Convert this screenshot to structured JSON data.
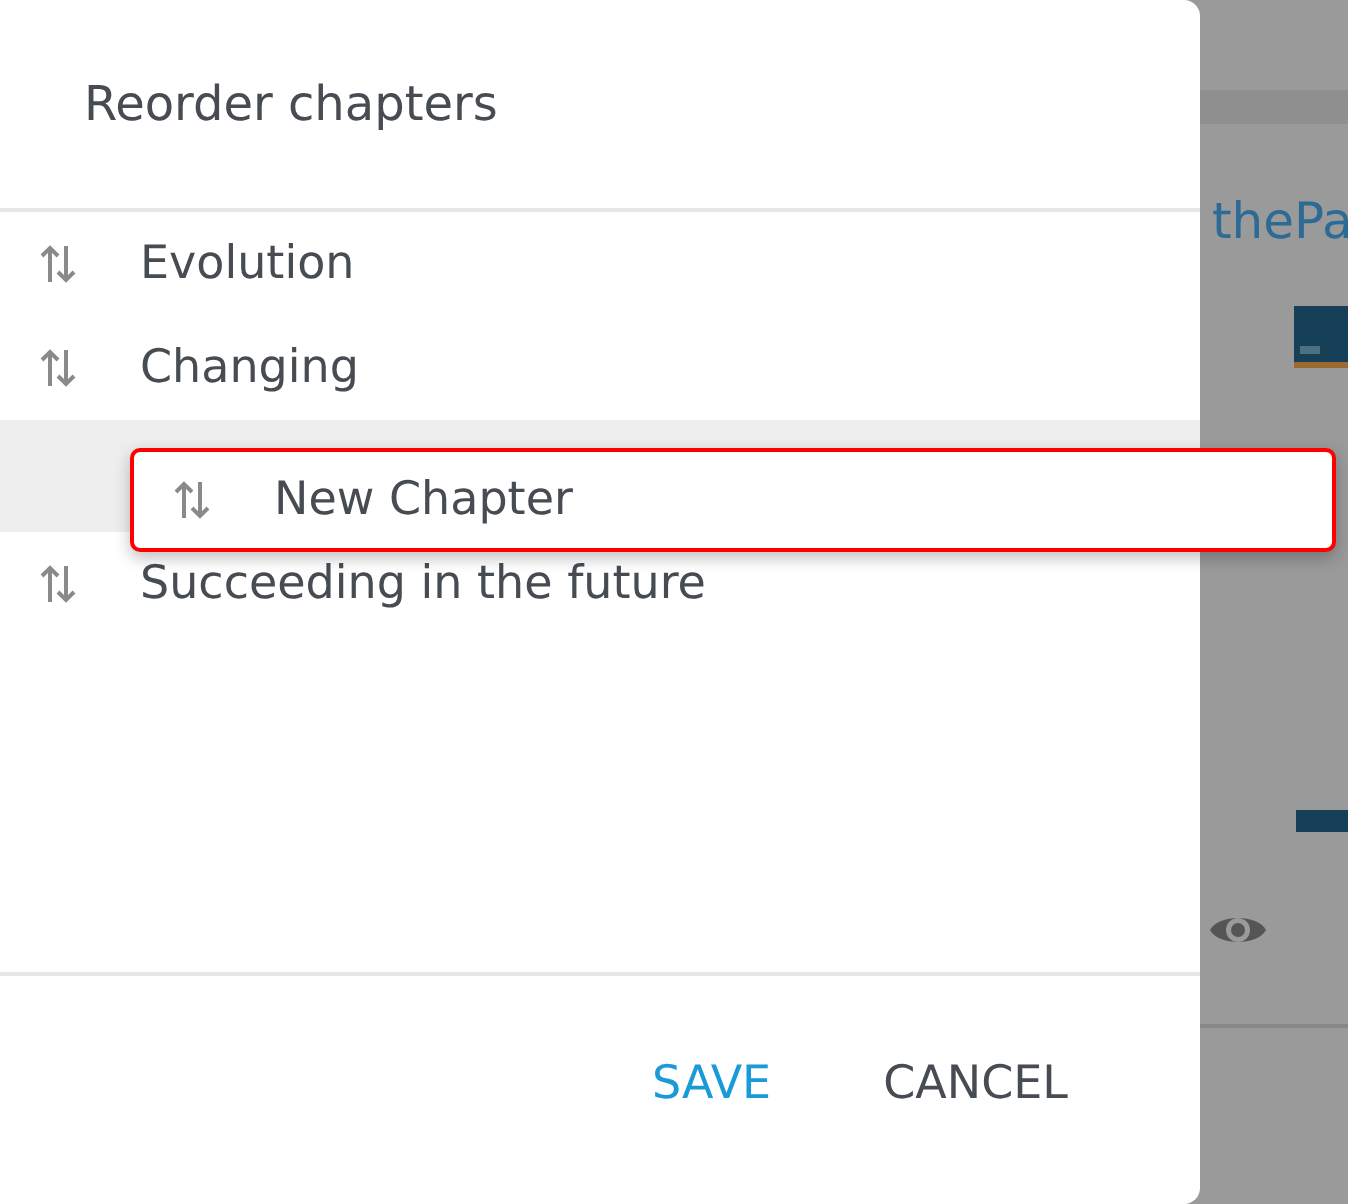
{
  "background": {
    "heading": "thePa"
  },
  "dialog": {
    "title": "Reorder chapters",
    "chapters": [
      {
        "kind": "item",
        "title": "Evolution"
      },
      {
        "kind": "item",
        "title": "Changing"
      },
      {
        "kind": "drop-placeholder"
      },
      {
        "kind": "item",
        "title": "Succeeding in the future"
      }
    ],
    "dragging": {
      "title": "New Chapter"
    },
    "buttons": [
      {
        "label": "SAVE",
        "primary": true
      },
      {
        "label": "CANCEL",
        "primary": false
      }
    ]
  }
}
